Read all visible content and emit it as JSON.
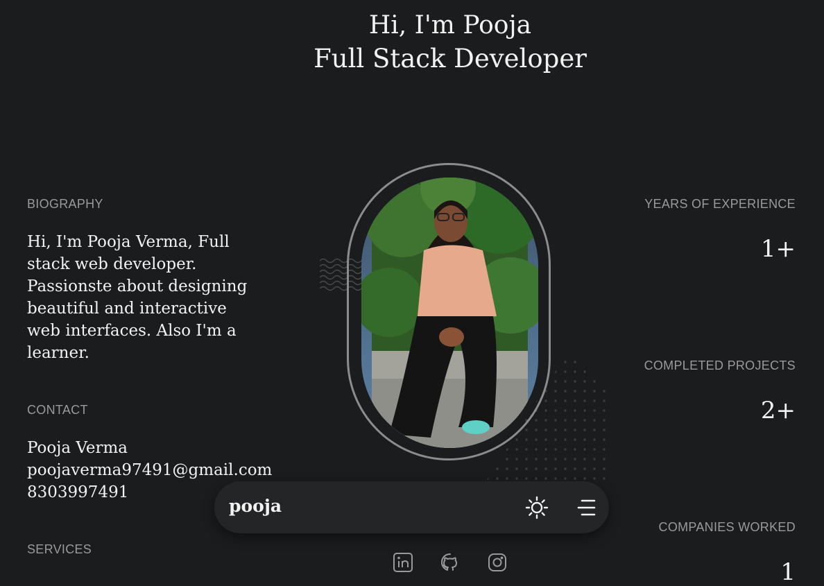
{
  "hero": {
    "line1": "Hi, I'm Pooja",
    "line2": "Full Stack Developer"
  },
  "left": {
    "biography_label": "BIOGRAPHY",
    "biography_text": "Hi, I'm Pooja Verma, Full stack web developer. Passionste about designing beautiful and interactive web interfaces. Also I'm a learner.",
    "contact_label": "CONTACT",
    "contact_name": "Pooja Verma",
    "contact_email": "poojaverma97491@gmail.com",
    "contact_phone": "8303997491",
    "services_label": "SERVICES"
  },
  "right": {
    "experience_label": "YEARS OF EXPERIENCE",
    "experience_value": "1+",
    "projects_label": "COMPLETED PROJECTS",
    "projects_value": "2+",
    "companies_label": "COMPANIES WORKED",
    "companies_value": "1"
  },
  "dock": {
    "brand": "pooja",
    "theme_icon": "sun-icon",
    "menu_icon": "menu-icon"
  },
  "social": [
    "linkedin-icon",
    "github-icon",
    "instagram-icon"
  ],
  "colors": {
    "background": "#1b1c1e",
    "text": "#f2f2f2",
    "muted": "#9a9a9a",
    "dock": "#242527",
    "frame": "#8c8c8c",
    "accent_blue": "#5d84a8"
  }
}
